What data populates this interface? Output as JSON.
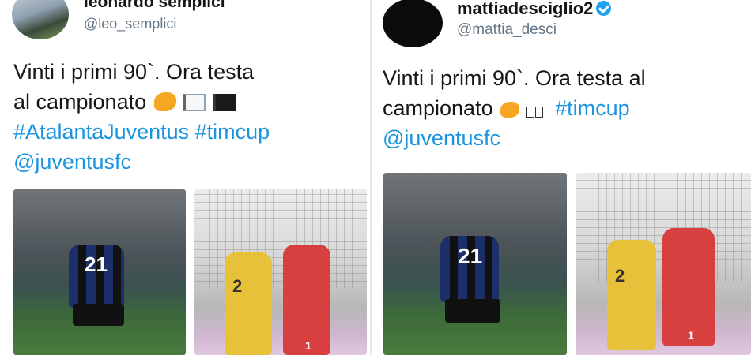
{
  "left_tweet": {
    "display_name": "leonardo semplici",
    "handle": "@leo_semplici",
    "text_line1": "Vinti i primi 90`. Ora testa",
    "text_line2_prefix": "al campionato",
    "hashtag_line": "#AtalantaJuventus #timcup",
    "mention": "@juventusfc",
    "photo_numbers": [
      "21",
      "2",
      "1"
    ]
  },
  "right_tweet": {
    "display_name": "mattiadesciglio2",
    "handle": "@mattia_desci",
    "text_line1": "Vinti i primi 90`. Ora testa al",
    "text_line2_prefix": "campionato",
    "hashtag": "#timcup",
    "mention": "@juventusfc",
    "photo_numbers": [
      "21",
      "2",
      "1"
    ]
  },
  "colors": {
    "link": "#1b95e0",
    "verified": "#1da1f2",
    "text": "#14171a",
    "muted": "#657786"
  },
  "icons": [
    "flexed-biceps-icon",
    "white-flag-icon",
    "black-flag-icon",
    "verified-badge-icon"
  ]
}
